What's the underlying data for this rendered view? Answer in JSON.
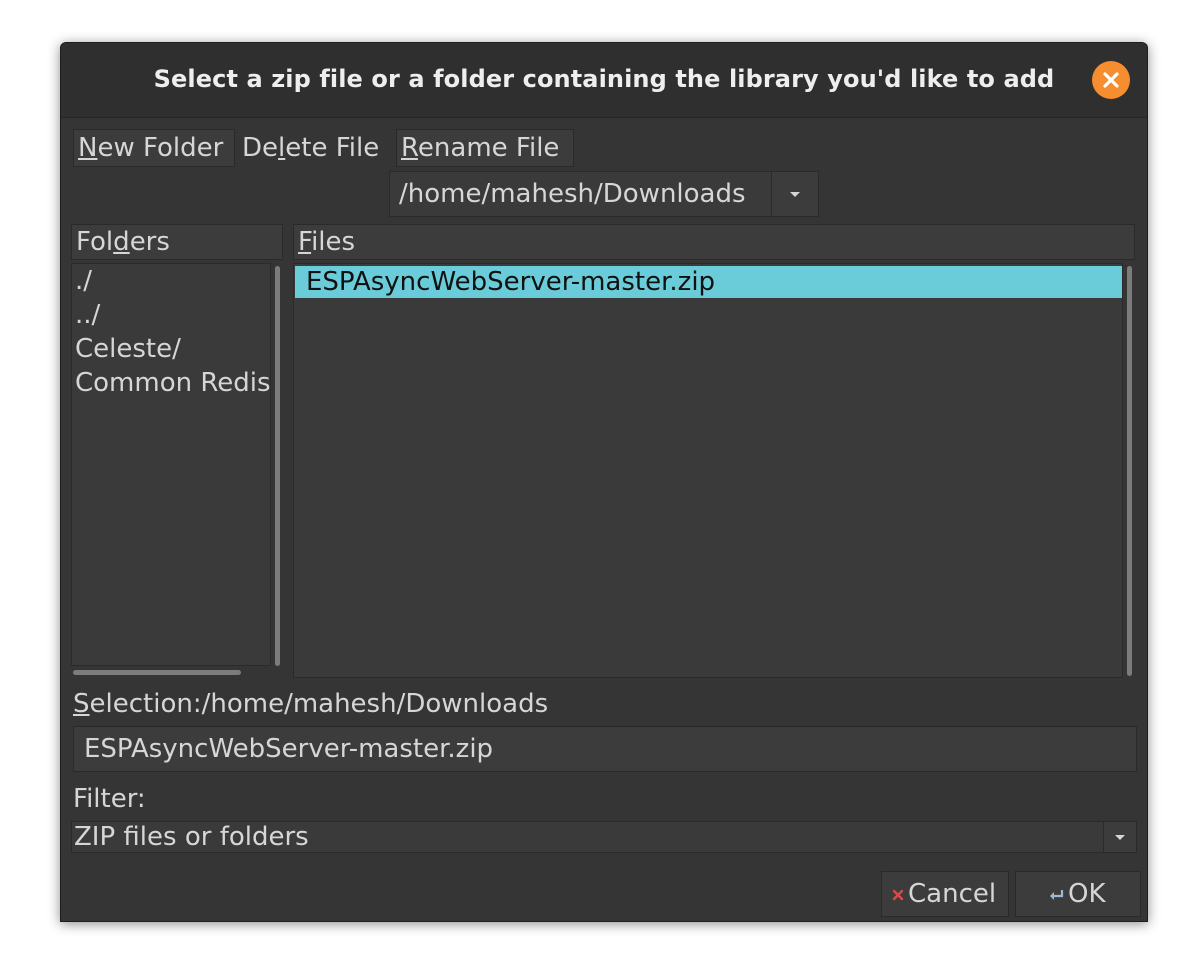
{
  "dialog": {
    "title": "Select a zip file or a folder containing the library you'd like to add"
  },
  "toolbar": {
    "new_folder": {
      "mnemonic": "N",
      "rest": "ew Folder"
    },
    "delete_file": {
      "pre": "De",
      "mnemonic": "l",
      "rest": "ete File"
    },
    "rename_file": {
      "mnemonic": "R",
      "rest": "ename File"
    }
  },
  "path": {
    "current": "/home/mahesh/Downloads"
  },
  "folders": {
    "header": {
      "pre": "Fol",
      "mnemonic": "d",
      "rest": "ers"
    },
    "items": [
      "./",
      "../",
      "Celeste/",
      "Common Redis"
    ]
  },
  "files": {
    "header": {
      "mnemonic": "F",
      "rest": "iles"
    },
    "items": [
      "ESPAsyncWebServer-master.zip"
    ]
  },
  "selection": {
    "label_mnemonic": "S",
    "label_rest": "election:",
    "path": "/home/mahesh/Downloads",
    "value": "ESPAsyncWebServer-master.zip"
  },
  "filter": {
    "label": "Filter:",
    "selected": "ZIP files or folders"
  },
  "buttons": {
    "cancel": "Cancel",
    "ok": "OK"
  },
  "icons": {
    "close": "close-icon",
    "cancel": "cancel-x-icon",
    "ok": "ok-enter-icon",
    "dropdown": "chevron-down-icon"
  },
  "colors": {
    "accent_close": "#f68d2e",
    "selection_highlight": "#6acbd9",
    "background": "#353535"
  }
}
